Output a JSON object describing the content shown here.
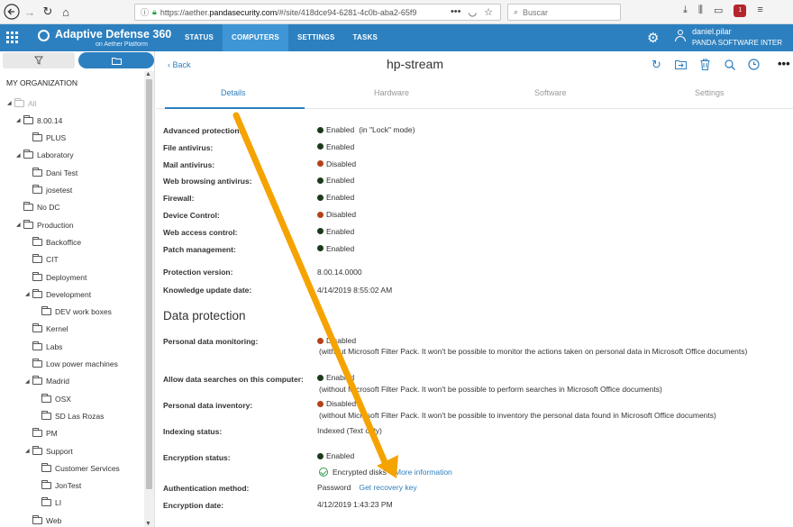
{
  "browser": {
    "back_icon": "arrow-left-icon",
    "url_prefix": "https://aether.",
    "url_domain": "pandasecurity.com",
    "url_rest": "/#/site/418dce94-6281-4c0b-aba2-65f9",
    "url_more": "•••",
    "search_placeholder": "Buscar"
  },
  "app": {
    "brand_title": "Adaptive Defense 360",
    "brand_subtitle": "on Aether Platform",
    "nav": [
      "STATUS",
      "COMPUTERS",
      "SETTINGS",
      "TASKS"
    ],
    "active_nav": "COMPUTERS",
    "user_name": "daniel.pilar",
    "user_org": "PANDA SOFTWARE INTER",
    "accent": "#2d80bf"
  },
  "sidebar": {
    "heading": "MY ORGANIZATION",
    "tree": [
      {
        "label": "All",
        "level": 0,
        "caret": "▲",
        "kind": "all"
      },
      {
        "label": "8.00.14",
        "level": 1,
        "caret": "▲"
      },
      {
        "label": "PLUS",
        "level": 2,
        "caret": ""
      },
      {
        "label": "Laboratory",
        "level": 1,
        "caret": "▲"
      },
      {
        "label": "Dani Test",
        "level": 2,
        "caret": ""
      },
      {
        "label": "josetest",
        "level": 2,
        "caret": ""
      },
      {
        "label": "No DC",
        "level": 1,
        "caret": ""
      },
      {
        "label": "Production",
        "level": 1,
        "caret": "▲"
      },
      {
        "label": "Backoffice",
        "level": 2,
        "caret": ""
      },
      {
        "label": "CIT",
        "level": 2,
        "caret": ""
      },
      {
        "label": "Deployment",
        "level": 2,
        "caret": ""
      },
      {
        "label": "Development",
        "level": 2,
        "caret": "▲"
      },
      {
        "label": "DEV work boxes",
        "level": 3,
        "caret": ""
      },
      {
        "label": "Kernel",
        "level": 2,
        "caret": ""
      },
      {
        "label": "Labs",
        "level": 2,
        "caret": ""
      },
      {
        "label": "Low power machines",
        "level": 2,
        "caret": ""
      },
      {
        "label": "Madrid",
        "level": 2,
        "caret": "▲"
      },
      {
        "label": "OSX",
        "level": 3,
        "caret": ""
      },
      {
        "label": "SD Las Rozas",
        "level": 3,
        "caret": ""
      },
      {
        "label": "PM",
        "level": 2,
        "caret": ""
      },
      {
        "label": "Support",
        "level": 2,
        "caret": "▲"
      },
      {
        "label": "Customer Services",
        "level": 3,
        "caret": ""
      },
      {
        "label": "JonTest",
        "level": 3,
        "caret": ""
      },
      {
        "label": "LI",
        "level": 3,
        "caret": ""
      },
      {
        "label": "Web",
        "level": 2,
        "caret": ""
      }
    ]
  },
  "main": {
    "back_label": "Back",
    "device_name": "hp-stream",
    "tabs": [
      "Details",
      "Hardware",
      "Software",
      "Settings"
    ],
    "active_tab": "Details",
    "protection_rows": [
      {
        "label": "Advanced protection:",
        "status": "green",
        "value": "Enabled",
        "extra": "(in \"Lock\" mode)"
      },
      {
        "label": "File antivirus:",
        "status": "green",
        "value": "Enabled",
        "extra": ""
      },
      {
        "label": "Mail antivirus:",
        "status": "red",
        "value": "Disabled",
        "extra": ""
      },
      {
        "label": "Web browsing antivirus:",
        "status": "green",
        "value": "Enabled",
        "extra": ""
      },
      {
        "label": "Firewall:",
        "status": "green",
        "value": "Enabled",
        "extra": ""
      },
      {
        "label": "Device Control:",
        "status": "red",
        "value": "Disabled",
        "extra": ""
      },
      {
        "label": "Web access control:",
        "status": "green",
        "value": "Enabled",
        "extra": ""
      },
      {
        "label": "Patch management:",
        "status": "green",
        "value": "Enabled",
        "extra": ""
      }
    ],
    "protection_version_label": "Protection version:",
    "protection_version": "8.00.14.0000",
    "knowledge_label": "Knowledge update date:",
    "knowledge_date": "4/14/2019 8:55:02 AM",
    "data_protection_title": "Data protection",
    "pdm_label": "Personal data monitoring:",
    "pdm_value": "Disabled",
    "pdm_note": "(without Microsoft Filter Pack. It won't be possible to monitor the actions taken on personal data in Microsoft Office documents)",
    "search_label": "Allow data searches on this computer:",
    "search_value": "Enabled",
    "search_note": "(without Microsoft Filter Pack. It won't be possible to perform searches in Microsoft Office documents)",
    "inventory_label": "Personal data inventory:",
    "inventory_value": "Disabled",
    "inventory_note": "(without Microsoft Filter Pack. It won't be possible to inventory the personal data found in Microsoft Office documents)",
    "indexing_label": "Indexing status:",
    "indexing_value": "Indexed (Text only)",
    "encryption_label": "Encryption status:",
    "encryption_value": "Enabled",
    "encrypted_text": "Encrypted disks",
    "more_info_link": "More information",
    "auth_label": "Authentication method:",
    "auth_value": "Password",
    "recovery_link": "Get recovery key",
    "enc_date_label": "Encryption date:",
    "enc_date_value": "4/12/2019 1:43:23 PM",
    "arrow_color": "#f5a300"
  }
}
